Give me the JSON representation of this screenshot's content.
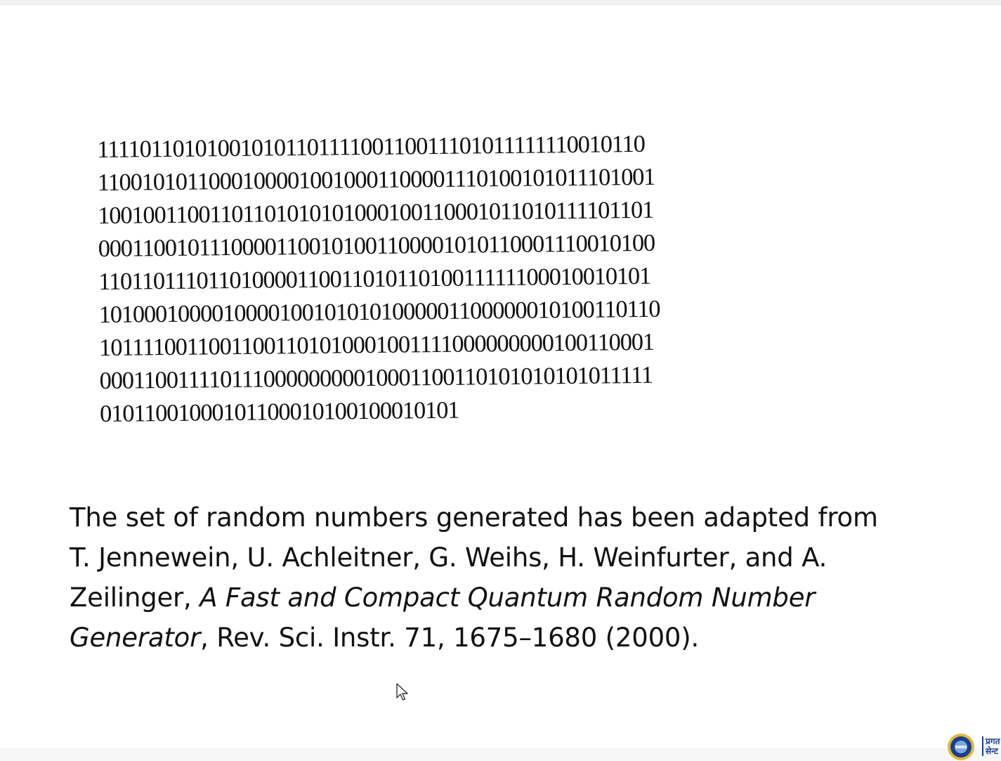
{
  "binary_lines": [
    "1111011010100101011011110011001110101111111001011​0",
    "1100101011000100001001000110000111010010101110100​1",
    "1001001100110110101010100010011000101101011110110​1",
    "0001100101110000110010100110000101011000111001010​0",
    "1101101110110100001100110101101001111110001001010​1",
    "1010001000010000100101010100000110000001010011011​0",
    "1011110011001100110101000100111100000000010011000​1",
    "0001100111101110000000001000110011010101010101111​1",
    "010110010001011000101001000101​01"
  ],
  "caption": {
    "line1": "The  set of random numbers generated has been adapted from",
    "line2": "T. Jennewein, U. Achleitner, G. Weihs, H. Weinfurter, and A.",
    "line3_plain": "Zeilinger, ",
    "line3_italic": "A Fast and Compact Quantum Random Number",
    "line4_italic": "Generator",
    "line4_plain": ", Rev. Sci. Instr. 71, 1675–1680 (2000)."
  },
  "logo": {
    "name": "institution-seal",
    "lettering": "प्रगत सेन्ट"
  },
  "colors": {
    "text": "#111111",
    "logo_blue": "#1a3d8f",
    "logo_gold": "#e0b83a"
  }
}
